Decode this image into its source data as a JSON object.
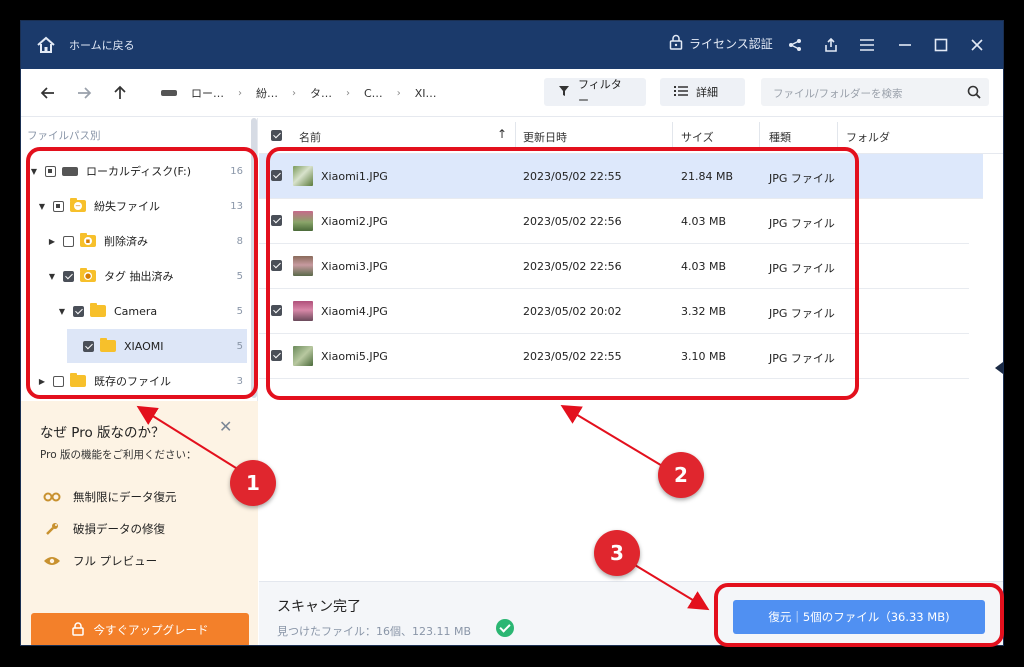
{
  "titlebar": {
    "home_label": "ホームに戻る",
    "license_label": "ライセンス認証",
    "icons": [
      "home-icon",
      "lock-icon",
      "share-icon",
      "export-icon",
      "menu-icon",
      "minimize-icon",
      "maximize-icon",
      "close-icon"
    ]
  },
  "navbar": {
    "breadcrumbs": [
      "ロー…",
      "紛…",
      "タ…",
      "C…",
      "XI…"
    ],
    "filter_label": "フィルター",
    "detail_label": "詳細",
    "search_placeholder": "ファイル/フォルダーを検索"
  },
  "sidebar": {
    "header": "ファイルパス別",
    "tree": [
      {
        "label": "ローカルディスク(F:)",
        "count": "16",
        "state": "mixed",
        "expanded": true,
        "icon": "drive-icon"
      },
      {
        "label": "紛失ファイル",
        "count": "13",
        "state": "mixed",
        "expanded": true,
        "icon": "lost-folder-icon"
      },
      {
        "label": "削除済み",
        "count": "8",
        "state": "unchecked",
        "expanded": false,
        "icon": "deleted-folder-icon"
      },
      {
        "label": "タグ 抽出済み",
        "count": "5",
        "state": "checked",
        "expanded": true,
        "icon": "tag-folder-icon"
      },
      {
        "label": "Camera",
        "count": "5",
        "state": "checked",
        "expanded": true,
        "icon": "folder-icon"
      },
      {
        "label": "XIAOMI",
        "count": "5",
        "state": "checked",
        "expanded": false,
        "icon": "folder-icon",
        "selected": true
      },
      {
        "label": "既存のファイル",
        "count": "3",
        "state": "unchecked",
        "expanded": false,
        "icon": "folder-icon"
      }
    ]
  },
  "promo": {
    "title": "なぜ Pro 版なのか？",
    "subtitle": "Pro 版の機能をご利用ください：",
    "features": [
      {
        "label": "無制限にデータ復元",
        "icon": "infinity-icon"
      },
      {
        "label": "破損データの修復",
        "icon": "wrench-icon"
      },
      {
        "label": "フル プレビュー",
        "icon": "eye-icon"
      }
    ],
    "upgrade_label": "今すぐアップグレード"
  },
  "table": {
    "headers": {
      "name": "名前",
      "date": "更新日時",
      "size": "サイズ",
      "type": "種類",
      "folder": "フォルダ"
    },
    "rows": [
      {
        "name": "Xiaomi1.JPG",
        "date": "2023/05/02 22:55",
        "size": "21.84 MB",
        "type": "JPG ファイル"
      },
      {
        "name": "Xiaomi2.JPG",
        "date": "2023/05/02 22:56",
        "size": "4.03 MB",
        "type": "JPG ファイル"
      },
      {
        "name": "Xiaomi3.JPG",
        "date": "2023/05/02 22:56",
        "size": "4.03 MB",
        "type": "JPG ファイル"
      },
      {
        "name": "Xiaomi4.JPG",
        "date": "2023/05/02 20:02",
        "size": "3.32 MB",
        "type": "JPG ファイル"
      },
      {
        "name": "Xiaomi5.JPG",
        "date": "2023/05/02 22:55",
        "size": "3.10 MB",
        "type": "JPG ファイル"
      }
    ]
  },
  "footer": {
    "scan_title": "スキャン完了",
    "scan_sub": "見つけたファイル：16個、123.11 MB",
    "recover_label": "復元｜5個のファイル（36.33 MB)"
  },
  "annotations": [
    "1",
    "2",
    "3"
  ],
  "colors": {
    "titlebar": "#1b3a6b",
    "highlight": "#e3101d",
    "accent": "#5090f2",
    "upgrade": "#f3802a"
  }
}
